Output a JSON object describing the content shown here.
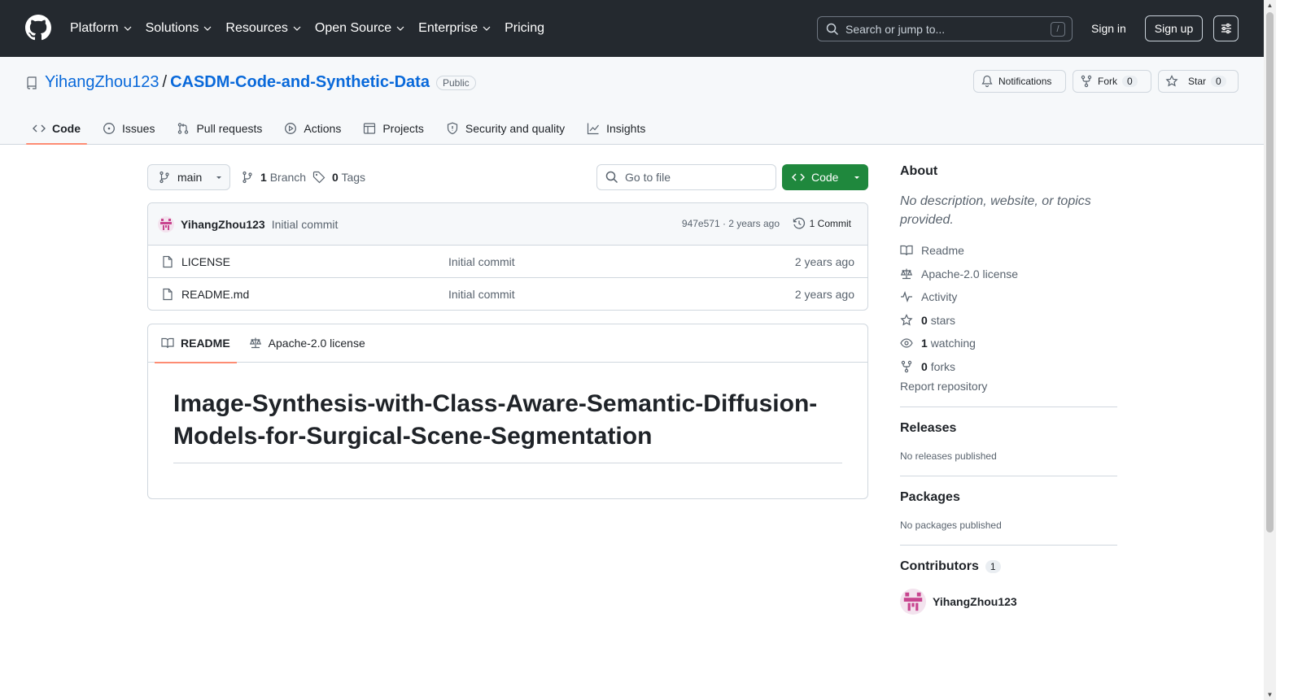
{
  "topnav": {
    "items": [
      {
        "label": "Platform",
        "dropdown": true
      },
      {
        "label": "Solutions",
        "dropdown": true
      },
      {
        "label": "Resources",
        "dropdown": true
      },
      {
        "label": "Open Source",
        "dropdown": true
      },
      {
        "label": "Enterprise",
        "dropdown": true
      },
      {
        "label": "Pricing",
        "dropdown": false
      }
    ],
    "search_placeholder": "Search or jump to...",
    "search_shortcut": "/",
    "signin": "Sign in",
    "signup": "Sign up"
  },
  "repo": {
    "owner": "YihangZhou123",
    "separator": "/",
    "name": "CASDM-Code-and-Synthetic-Data",
    "visibility": "Public",
    "notifications": "Notifications",
    "fork_label": "Fork",
    "fork_count": "0",
    "star_label": "Star",
    "star_count": "0"
  },
  "tabs": [
    {
      "label": "Code",
      "icon": "code-icon",
      "active": true
    },
    {
      "label": "Issues",
      "icon": "issue-icon",
      "active": false
    },
    {
      "label": "Pull requests",
      "icon": "pull-request-icon",
      "active": false
    },
    {
      "label": "Actions",
      "icon": "play-icon",
      "active": false
    },
    {
      "label": "Projects",
      "icon": "table-icon",
      "active": false
    },
    {
      "label": "Security and quality",
      "icon": "shield-icon",
      "active": false
    },
    {
      "label": "Insights",
      "icon": "graph-icon",
      "active": false
    }
  ],
  "toolbar": {
    "branch": "main",
    "branch_count": "1",
    "branch_label": "Branch",
    "tag_count": "0",
    "tag_label": "Tags",
    "goto_placeholder": "Go to file",
    "code_button": "Code"
  },
  "latest_commit": {
    "author": "YihangZhou123",
    "message": "Initial commit",
    "meta": "947e571 · 2 years ago",
    "commits": "1 Commit"
  },
  "files": [
    {
      "name": "LICENSE",
      "message": "Initial commit",
      "date": "2 years ago"
    },
    {
      "name": "README.md",
      "message": "Initial commit",
      "date": "2 years ago"
    }
  ],
  "readme": {
    "tab_readme": "README",
    "tab_license": "Apache-2.0 license",
    "heading": "Image-Synthesis-with-Class-Aware-Semantic-Diffusion-Models-for-Surgical-Scene-Segmentation"
  },
  "about": {
    "title": "About",
    "description": "No description, website, or topics provided.",
    "readme": "Readme",
    "license": "Apache-2.0 license",
    "activity": "Activity",
    "stars_count": "0",
    "stars_label": "stars",
    "watching_count": "1",
    "watching_label": "watching",
    "forks_count": "0",
    "forks_label": "forks",
    "report": "Report repository"
  },
  "releases": {
    "title": "Releases",
    "empty": "No releases published"
  },
  "packages": {
    "title": "Packages",
    "empty": "No packages published"
  },
  "contributors": {
    "title": "Contributors",
    "count": "1",
    "name": "YihangZhou123"
  },
  "colors": {
    "accent": "#0969da",
    "code_button": "#1f883d",
    "tab_underline": "#fd8c73",
    "header_bg": "#24292f"
  }
}
